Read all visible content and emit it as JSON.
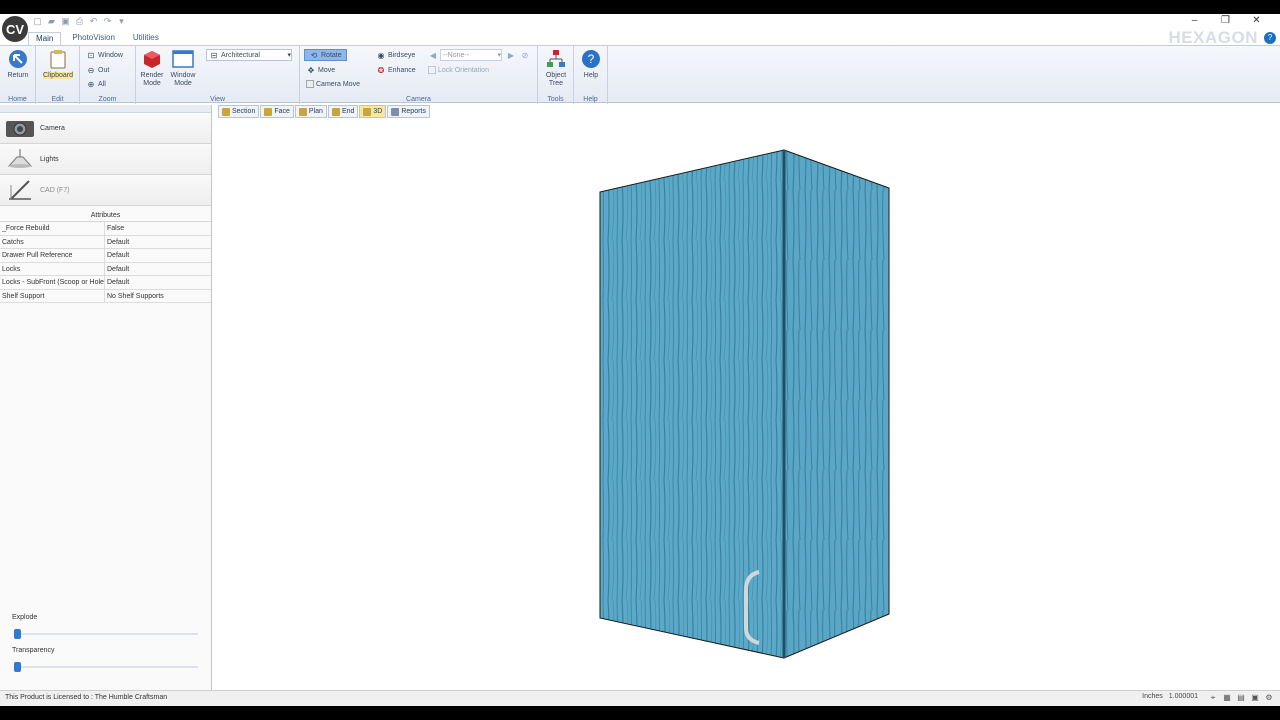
{
  "app": {
    "logo": "CV"
  },
  "tabs": [
    "Main",
    "PhotoVision",
    "Utilities"
  ],
  "brand": {
    "name": "HEXAGON",
    "help": "?"
  },
  "window_controls": [
    "–",
    "❐",
    "✕"
  ],
  "ribbon": {
    "home": {
      "return_label": "Return",
      "group": "Home"
    },
    "edit": {
      "clipboard_label": "Clipboard",
      "group": "Edit"
    },
    "zoom": {
      "window": "Window",
      "out": "Out",
      "all": "All",
      "group": "Zoom"
    },
    "view": {
      "render_mode": "Render Mode",
      "window_mode": "Window Mode",
      "style_value": "Architectural",
      "group": "View"
    },
    "camera": {
      "rotate": "Rotate",
      "move": "Move",
      "camera_move": "Camera Move",
      "birdseye": "Birdseye",
      "enhance": "Enhance",
      "preset_value": "--None--",
      "lock_orientation": "Lock Orientation",
      "group": "Camera"
    },
    "tools": {
      "object_tree": "Object Tree",
      "group": "Tools"
    },
    "help": {
      "label": "Help",
      "group": "Help"
    }
  },
  "viewbar": [
    "Section",
    "Face",
    "Plan",
    "End",
    "3D",
    "Reports"
  ],
  "left_panel": {
    "items": [
      {
        "label": "Camera"
      },
      {
        "label": "Lights"
      },
      {
        "label": "CAD (F7)"
      }
    ],
    "attributes_title": "Attributes",
    "attributes": [
      {
        "key": "_Force Rebuild",
        "value": "False"
      },
      {
        "key": "Catchs",
        "value": "Default"
      },
      {
        "key": "Drawer Pull Reference",
        "value": "Default"
      },
      {
        "key": "Locks",
        "value": "Default"
      },
      {
        "key": "Locks - SubFront (Scoop or Hole",
        "value": "Default"
      },
      {
        "key": "Shelf Support",
        "value": "No Shelf Supports"
      }
    ],
    "explode_label": "Explode",
    "transparency_label": "Transparency",
    "explode_level": 0,
    "transparency_level": 0
  },
  "status": {
    "license": "This Product is Licensed to : The Humble Craftsman",
    "units": "Inches",
    "scale": "1.000001"
  },
  "colors": {
    "wood": "#5aa9c9",
    "wood_dark": "#2f6f88",
    "accent": "#2f7bd2"
  }
}
